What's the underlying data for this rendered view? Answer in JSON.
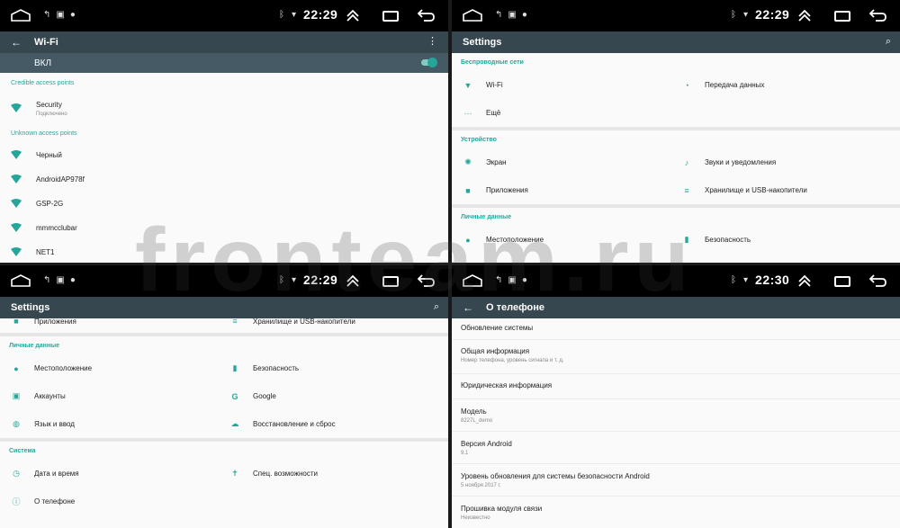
{
  "status": {
    "times": [
      "22:29",
      "22:29",
      "22:29",
      "22:30"
    ]
  },
  "panel1": {
    "title": "Wi-Fi",
    "toggle_label": "ВКЛ",
    "credible_header": "Credible access points",
    "unknown_header": "Unknown access points",
    "credible": [
      {
        "name": "Security",
        "sub": "Подключено"
      }
    ],
    "unknown": [
      "Черный",
      "AndroidAP978f",
      "GSP-2G",
      "mmmcclubar",
      "NET1"
    ]
  },
  "panel2": {
    "title": "Settings",
    "wireless_header": "Беспроводные сети",
    "wifi": "Wi-Fi",
    "data": "Передача данных",
    "more": "Ещё",
    "device_header": "Устройство",
    "screen": "Экран",
    "sounds": "Звуки и уведомления",
    "apps": "Приложения",
    "storage": "Хранилище и USB-накопители",
    "personal_header": "Личные данные",
    "location": "Местоположение",
    "security": "Безопасность"
  },
  "panel3": {
    "title": "Settings",
    "apps": "Приложения",
    "storage": "Хранилище и USB-накопители",
    "personal_header": "Личные данные",
    "location": "Местоположение",
    "security": "Безопасность",
    "accounts": "Аккаунты",
    "google": "Google",
    "language": "Язык и ввод",
    "backup": "Восстановление и сброс",
    "system_header": "Система",
    "datetime": "Дата и время",
    "accessibility": "Спец. возможности",
    "about": "О телефоне"
  },
  "panel4": {
    "title": "О телефоне",
    "rows": [
      {
        "t": "Обновление системы",
        "s": ""
      },
      {
        "t": "Общая информация",
        "s": "Номер телефона, уровень сигнала и т. д."
      },
      {
        "t": "Юридическая информация",
        "s": ""
      },
      {
        "t": "Модель",
        "s": "8227L_demo"
      },
      {
        "t": "Версия Android",
        "s": "9.1"
      },
      {
        "t": "Уровень обновления для системы безопасности Android",
        "s": "5 ноября 2017 г."
      },
      {
        "t": "Прошивка модуля связи",
        "s": "Неизвестно"
      }
    ]
  },
  "watermark": "fronteam.ru",
  "colors": {
    "accent": "#26a69a",
    "appbar": "#37474f",
    "togglebar": "#455a64"
  }
}
